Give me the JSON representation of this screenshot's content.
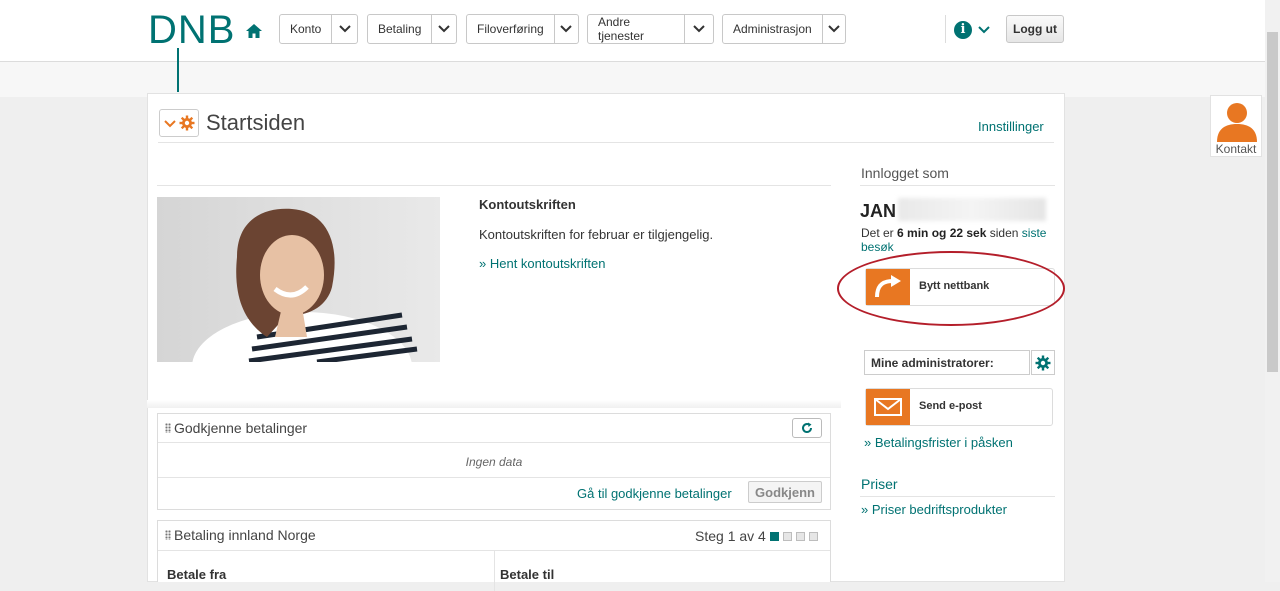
{
  "header": {
    "logo": "DNB",
    "nav": [
      {
        "label": "Konto"
      },
      {
        "label": "Betaling"
      },
      {
        "label": "Filoverføring"
      },
      {
        "label": "Andre tjenester"
      },
      {
        "label": "Administrasjon"
      }
    ],
    "logout_label": "Logg ut"
  },
  "contact": {
    "label": "Kontakt"
  },
  "page": {
    "title": "Startsiden",
    "settings_link": "Innstillinger"
  },
  "statement": {
    "title": "Kontoutskriften",
    "text": "Kontoutskriften for februar er tilgjengelig.",
    "link": "» Hent kontoutskriften"
  },
  "approve_widget": {
    "title": "Godkjenne betalinger",
    "empty_text": "Ingen data",
    "link": "Gå til godkjenne betalinger",
    "button": "Godkjenn"
  },
  "payment_widget": {
    "title": "Betaling innland Norge",
    "step_text": "Steg 1 av 4",
    "current_step": 1,
    "total_steps": 4,
    "col_from": "Betale fra",
    "col_to": "Betale til"
  },
  "sidebar": {
    "logged_in_label": "Innlogget som",
    "user_first_name": "JAN",
    "visit_prefix": "Det er",
    "visit_time": "6 min og 22 sek",
    "visit_middle": "siden",
    "visit_link": "siste besøk",
    "switch_bank": "Bytt nettbank",
    "admins_select": "Mine administratorer:",
    "send_email": "Send e-post",
    "easter_link": "» Betalingsfrister i påsken",
    "prices_title": "Priser",
    "prices_link": "» Priser bedriftsprodukter"
  },
  "colors": {
    "brand": "#007272",
    "accent": "#e87722",
    "highlight_ellipse": "#b41e2a"
  }
}
